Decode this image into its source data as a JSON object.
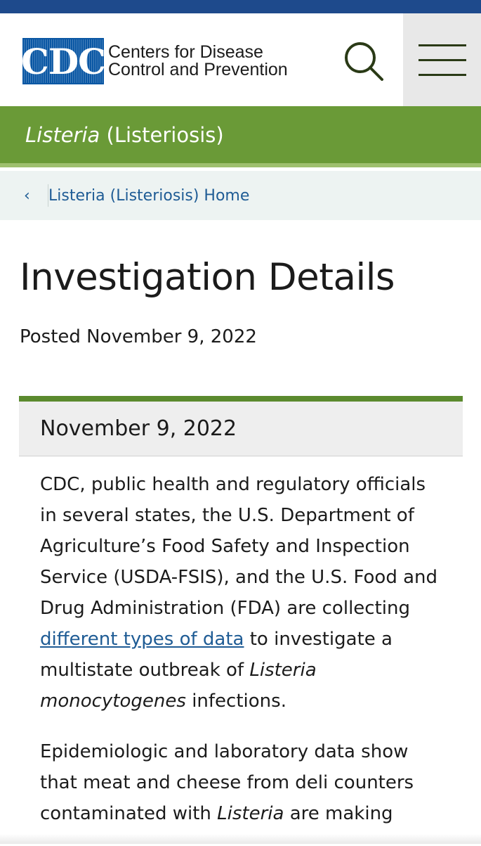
{
  "header": {
    "logo_text": "CDC",
    "org_name_line1": "Centers for Disease",
    "org_name_line2": "Control and Prevention",
    "icons": [
      "search-icon",
      "menu-icon"
    ]
  },
  "site": {
    "title_italic": "Listeria",
    "title_rest": " (Listeriosis)"
  },
  "breadcrumb": {
    "chevron": "‹",
    "label": "Listeria (Listeriosis) Home"
  },
  "main": {
    "title": "Investigation Details",
    "posted": "Posted November 9, 2022"
  },
  "card": {
    "date": "November 9, 2022",
    "p1_a": "CDC, public health and regulatory officials in several states, the U.S. Department of Agriculture’s Food Safety and Inspection Service (USDA-FSIS), and the U.S. Food and Drug Administration (FDA) are collecting ",
    "p1_link": "different types of data",
    "p1_b": " to investigate a multistate outbreak of ",
    "p1_italic": "Listeria monocytogenes",
    "p1_c": " infections.",
    "p2_a": "Epidemiologic and laboratory data show that meat and cheese from deli counters contaminated with ",
    "p2_italic": "Listeria",
    "p2_b": " are making"
  },
  "colors": {
    "top_bar": "#1e4a8c",
    "banner": "#6a9a37",
    "card_border": "#5b8a2e",
    "link": "#1f5c95"
  }
}
